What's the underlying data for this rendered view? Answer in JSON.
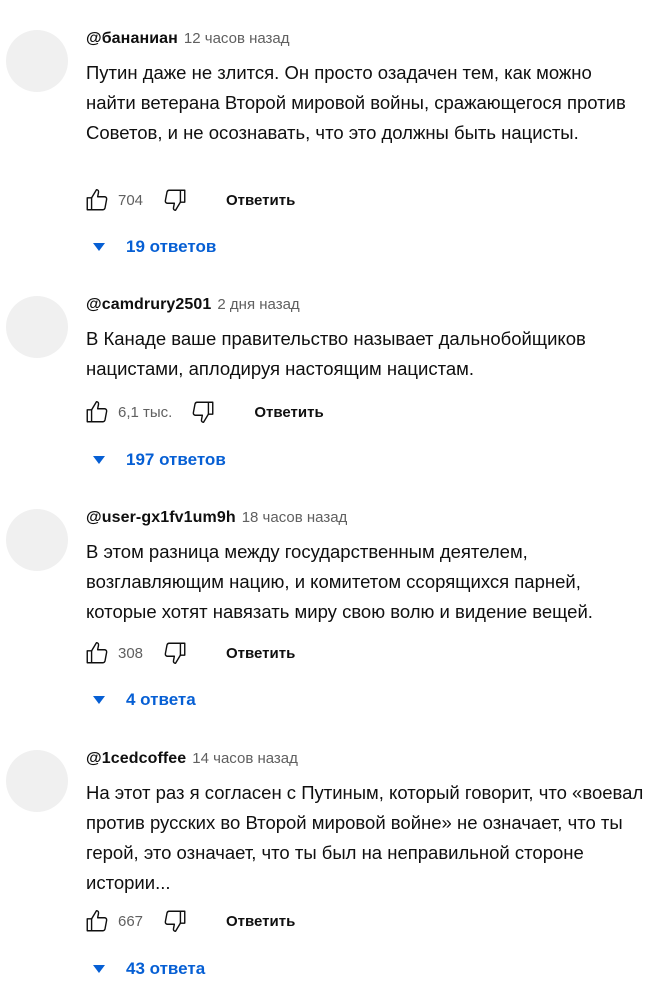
{
  "comments": [
    {
      "author": "@бананиан",
      "time": "12 часов назад",
      "text": "Путин даже не злится. Он просто озадачен тем, как можно найти ветерана Второй мировой войны, сражающегося против Советов, и не осознавать, что это должны быть нацисты.",
      "likes": "704",
      "reply_label": "Ответить",
      "replies_label": "19 ответов"
    },
    {
      "author": "@camdrury2501",
      "time": "2 дня назад",
      "text": "В Канаде ваше правительство называет дальнобойщиков нацистами, аплодируя настоящим нацистам.",
      "likes": "6,1 тыс.",
      "reply_label": "Ответить",
      "replies_label": "197 ответов"
    },
    {
      "author": "@user-gx1fv1um9h",
      "time": "18 часов назад",
      "text": "В этом разница между государственным деятелем, возглавляющим нацию, и комитетом ссорящихся парней, которые хотят навязать миру свою волю и видение вещей.",
      "likes": "308",
      "reply_label": "Ответить",
      "replies_label": "4 ответа"
    },
    {
      "author": "@1cedcoffee",
      "time": "14 часов назад",
      "text": "На этот раз я согласен с Путиным, который говорит, что «воевал против русских во Второй мировой войне» не означает, что ты герой, это означает, что ты был на неправильной стороне истории...",
      "likes": "667",
      "reply_label": "Ответить",
      "replies_label": "43 ответа"
    }
  ],
  "icons": {
    "like": "thumb-up-icon",
    "dislike": "thumb-down-icon",
    "expand": "caret-down-icon"
  },
  "colors": {
    "link": "#065fd4",
    "meta": "#606060",
    "avatar": "#f0f0f0"
  }
}
